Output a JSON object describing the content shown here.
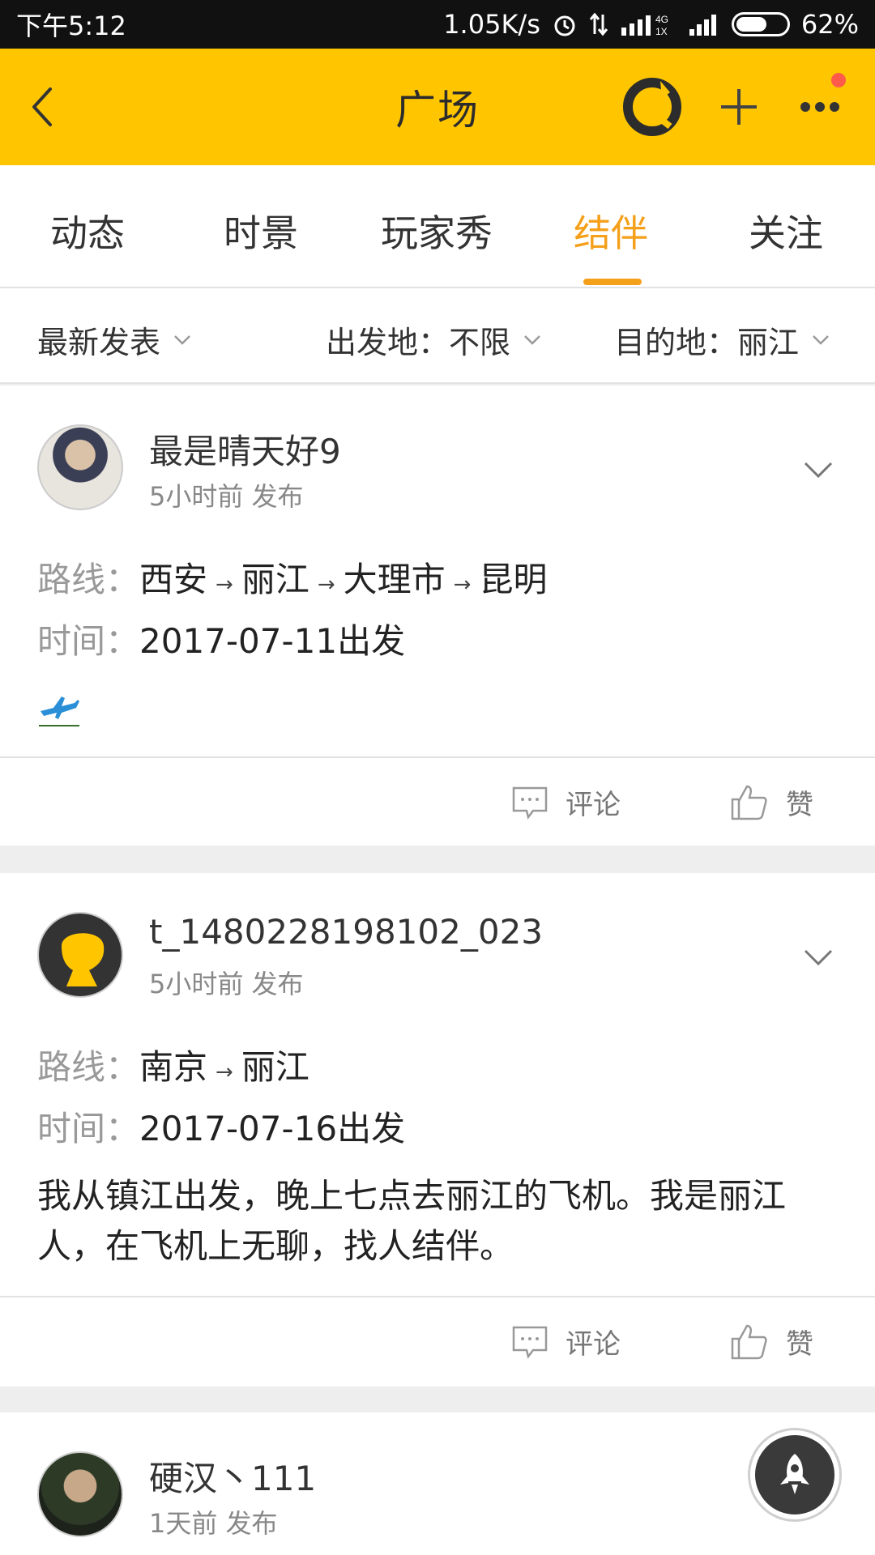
{
  "status_bar": {
    "time": "下午5:12",
    "network_speed": "1.05K/s",
    "battery": "62%",
    "battery_level": 0.62
  },
  "header": {
    "title": "广场"
  },
  "tabs": [
    {
      "label": "动态"
    },
    {
      "label": "时景"
    },
    {
      "label": "玩家秀"
    },
    {
      "label": "结伴",
      "active": true
    },
    {
      "label": "关注"
    }
  ],
  "filters": {
    "sort": "最新发表",
    "origin": "出发地：不限",
    "destination": "目的地：丽江"
  },
  "labels": {
    "route": "路线：",
    "time": "时间：",
    "comment": "评论",
    "like": "赞"
  },
  "posts": [
    {
      "username": "最是晴天好9",
      "posted": "5小时前 发布",
      "route": [
        "西安",
        "丽江",
        "大理市",
        "昆明"
      ],
      "date": "2017-07-11出发",
      "desc_icon": "airplane-icon"
    },
    {
      "username": "t_1480228198102_023",
      "posted": "5小时前 发布",
      "route": [
        "南京",
        "丽江"
      ],
      "date": "2017-07-16出发",
      "description": "我从镇江出发，晚上七点去丽江的飞机。我是丽江人，在飞机上无聊，找人结伴。"
    },
    {
      "username": "硬汉丶111",
      "posted": "1天前 发布"
    }
  ],
  "colors": {
    "accent": "#ffc600",
    "active_tab": "#f5a01a",
    "badge": "#ff5a4a"
  }
}
